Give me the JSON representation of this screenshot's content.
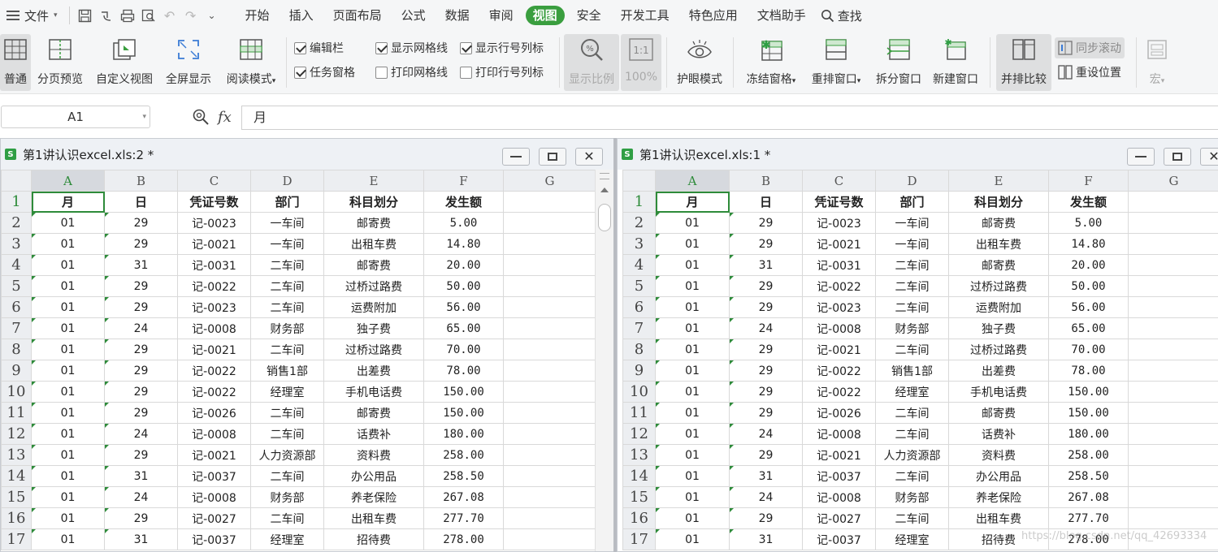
{
  "menu": {
    "file_label": "文件",
    "tabs": [
      "开始",
      "插入",
      "页面布局",
      "公式",
      "数据",
      "审阅",
      "视图",
      "安全",
      "开发工具",
      "特色应用",
      "文档助手"
    ],
    "active_tab": "视图",
    "search_label": "查找"
  },
  "ribbon": {
    "normal": "普通",
    "page_break": "分页预览",
    "custom_view": "自定义视图",
    "fullscreen": "全屏显示",
    "reading_mode": "阅读模式",
    "chk_editbar": "编辑栏",
    "chk_taskpane": "任务窗格",
    "chk_gridlines": "显示网格线",
    "chk_print_grid": "打印网格线",
    "chk_headings": "显示行号列标",
    "chk_print_headings": "打印行号列标",
    "zoom": "显示比例",
    "zoom_100": "100%",
    "eye_mode": "护眼模式",
    "freeze": "冻结窗格",
    "arrange": "重排窗口",
    "split": "拆分窗口",
    "new_window": "新建窗口",
    "side_by_side": "并排比较",
    "sync_scroll": "同步滚动",
    "reset_position": "重设位置",
    "macro": "宏"
  },
  "formula_bar": {
    "cell_ref": "A1",
    "fx": "fx",
    "content": "月"
  },
  "windows": [
    {
      "title": "第1讲认识excel.xls:2 *"
    },
    {
      "title": "第1讲认识excel.xls:1 *"
    }
  ],
  "sheet": {
    "columns": [
      "A",
      "B",
      "C",
      "D",
      "E",
      "F",
      "G"
    ],
    "header": [
      "月",
      "日",
      "凭证号数",
      "部门",
      "科目划分",
      "发生额"
    ],
    "rows": [
      [
        "01",
        "29",
        "记-0023",
        "一车间",
        "邮寄费",
        "5.00"
      ],
      [
        "01",
        "29",
        "记-0021",
        "一车间",
        "出租车费",
        "14.80"
      ],
      [
        "01",
        "31",
        "记-0031",
        "二车间",
        "邮寄费",
        "20.00"
      ],
      [
        "01",
        "29",
        "记-0022",
        "二车间",
        "过桥过路费",
        "50.00"
      ],
      [
        "01",
        "29",
        "记-0023",
        "二车间",
        "运费附加",
        "56.00"
      ],
      [
        "01",
        "24",
        "记-0008",
        "财务部",
        "独子费",
        "65.00"
      ],
      [
        "01",
        "29",
        "记-0021",
        "二车间",
        "过桥过路费",
        "70.00"
      ],
      [
        "01",
        "29",
        "记-0022",
        "销售1部",
        "出差费",
        "78.00"
      ],
      [
        "01",
        "29",
        "记-0022",
        "经理室",
        "手机电话费",
        "150.00"
      ],
      [
        "01",
        "29",
        "记-0026",
        "二车间",
        "邮寄费",
        "150.00"
      ],
      [
        "01",
        "24",
        "记-0008",
        "二车间",
        "话费补",
        "180.00"
      ],
      [
        "01",
        "29",
        "记-0021",
        "人力资源部",
        "资料费",
        "258.00"
      ],
      [
        "01",
        "31",
        "记-0037",
        "二车间",
        "办公用品",
        "258.50"
      ],
      [
        "01",
        "24",
        "记-0008",
        "财务部",
        "养老保险",
        "267.08"
      ],
      [
        "01",
        "29",
        "记-0027",
        "二车间",
        "出租车费",
        "277.70"
      ],
      [
        "01",
        "31",
        "记-0037",
        "经理室",
        "招待费",
        "278.00"
      ]
    ]
  },
  "watermark": "https://blog.csdn.net/qq_42693334"
}
